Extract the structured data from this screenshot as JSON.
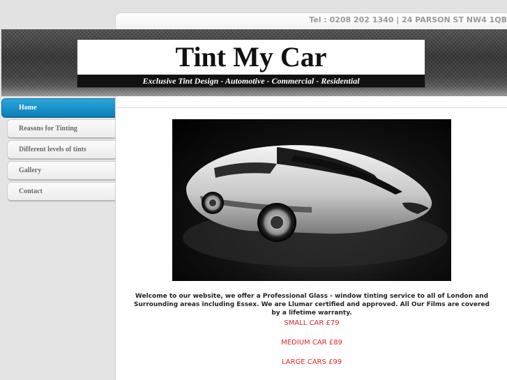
{
  "site": {
    "contact_line": "Tel : 0208 202 1340 | 24 PARSON ST NW4 1QB",
    "logo_title": "Tint My Car",
    "logo_tagline": "Exclusive Tint Design - Automotive - Commercial - Residential"
  },
  "nav": {
    "items": [
      {
        "label": "Home",
        "active": true
      },
      {
        "label": "Reasons for Tinting"
      },
      {
        "label": "Different levels of tints"
      },
      {
        "label": "Gallery"
      },
      {
        "label": "Contact"
      }
    ]
  },
  "main": {
    "intro": "Welcome to our website, we offer a Professional Glass - window tinting service to all of London and Surrounding areas including Essex. We are Llumar certified and approved. All Our Films are covered by a lifetime warranty.",
    "prices": [
      "SMALL CAR  £79",
      "MEDIUM CAR £89",
      "LARGE CARS £99"
    ]
  },
  "colors": {
    "nav_active": "#0a80b8",
    "price_red": "#e0252b"
  }
}
